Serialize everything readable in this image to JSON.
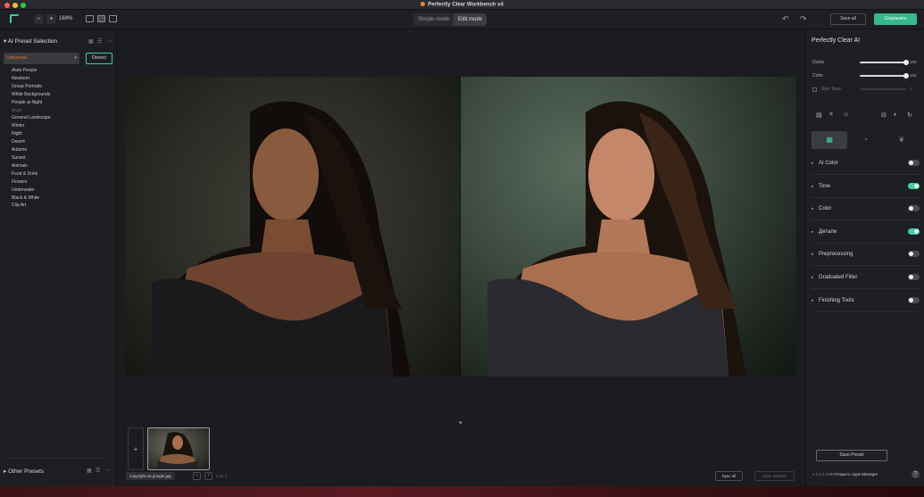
{
  "window": {
    "title": "Perfectly Clear Workbench v4"
  },
  "toolbar": {
    "zoom_out": "−",
    "zoom_in": "+",
    "zoom_level": "168%",
    "modes": [
      "Simple mode",
      "Edit mode"
    ],
    "active_mode": "Edit mode",
    "undo_icon": "↶",
    "redo_icon": "↷",
    "save_all": "Save all",
    "export": "Сохранить"
  },
  "left_panel": {
    "title": "AI Preset Selection",
    "selected_preset": "Universal",
    "detect_label": "Detect",
    "presets": [
      {
        "label": "iAuto People",
        "dim": false
      },
      {
        "label": "Newborn",
        "dim": false
      },
      {
        "label": "Group Portraits",
        "dim": false
      },
      {
        "label": "White Backgrounds",
        "dim": false
      },
      {
        "label": "People at Night",
        "dim": false
      },
      {
        "label": "iAuto",
        "dim": true
      },
      {
        "label": "General Landscape",
        "dim": false
      },
      {
        "label": "Winter",
        "dim": false
      },
      {
        "label": "Night",
        "dim": false
      },
      {
        "label": "Desert",
        "dim": false
      },
      {
        "label": "Autumn",
        "dim": false
      },
      {
        "label": "Sunset",
        "dim": false
      },
      {
        "label": "Animals",
        "dim": false
      },
      {
        "label": "Food & Drink",
        "dim": false
      },
      {
        "label": "Flowers",
        "dim": false
      },
      {
        "label": "Underwater",
        "dim": false
      },
      {
        "label": "Black & White",
        "dim": false
      },
      {
        "label": "Clip Art",
        "dim": false
      }
    ],
    "other_presets": "Other Presets"
  },
  "center": {
    "add_image": "+",
    "file_name": "copyright на google.jpg",
    "page_prev": "‹",
    "page_next": "›",
    "page_count": "1 из 1",
    "sync_all": "Sync all",
    "sync_forward": "Sync forward",
    "collapse_icon": "▾"
  },
  "right_panel": {
    "title": "Perfectly Clear AI",
    "sliders": [
      {
        "label": "Gains",
        "value": 100
      },
      {
        "label": "Color",
        "value": 100
      }
    ],
    "skin_tone": {
      "label": "Skin Tone",
      "value": "0"
    },
    "sections": [
      {
        "label": "AI Color",
        "on": false
      },
      {
        "label": "Tone",
        "on": true
      },
      {
        "label": "Color",
        "on": false
      },
      {
        "label": "Детали",
        "on": true
      },
      {
        "label": "Preprocessing",
        "on": false
      },
      {
        "label": "Graduated Filter",
        "on": false
      },
      {
        "label": "Finishing Tools",
        "on": false
      }
    ],
    "save_preset": "Save Preset",
    "version": "v 4.1.2.2290",
    "open_manager": "Открыть Apps Manager",
    "help": "?"
  },
  "colors": {
    "accent": "#3fcf9c",
    "preset_highlight": "#e2763b",
    "background": "#1b1c1f"
  }
}
